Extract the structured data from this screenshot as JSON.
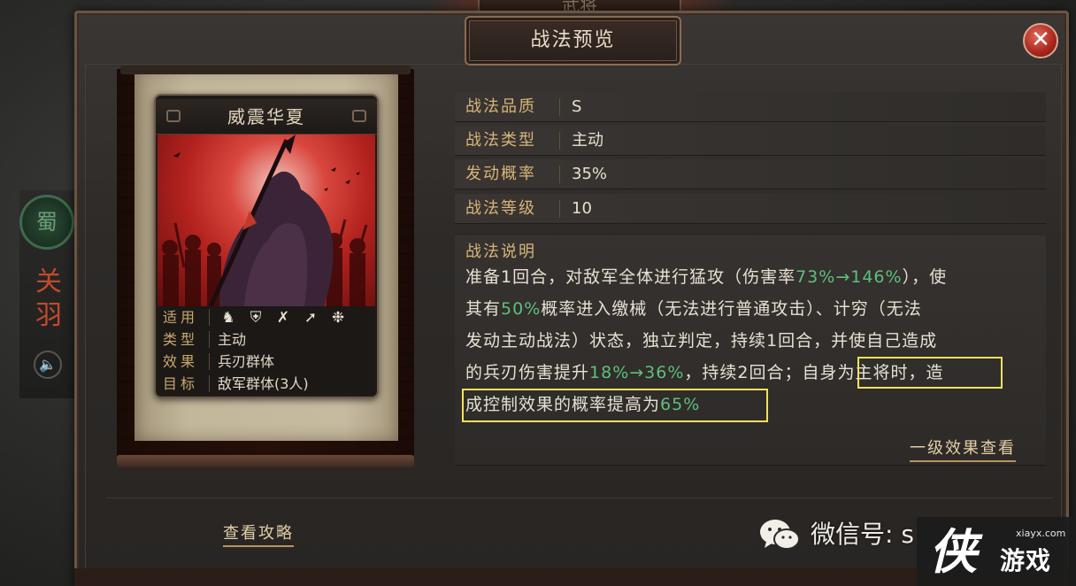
{
  "top_tab": {
    "label": "武将"
  },
  "side": {
    "nation": "蜀",
    "general_name": "关羽",
    "sound_icon": "speaker-icon"
  },
  "dialog": {
    "title": "战法预览",
    "close_icon": "close-icon"
  },
  "card": {
    "name": "威震华夏",
    "info": [
      {
        "key": "适用",
        "icons": [
          "cavalry-icon",
          "shield-icon",
          "bow-icon",
          "spear-icon",
          "wheel-icon"
        ]
      },
      {
        "key": "类型",
        "value": "主动"
      },
      {
        "key": "效果",
        "value": "兵刃群体"
      },
      {
        "key": "目标",
        "value": "敌军群体(3人)"
      }
    ]
  },
  "attributes": [
    {
      "key": "战法品质",
      "value": "S"
    },
    {
      "key": "战法类型",
      "value": "主动"
    },
    {
      "key": "发动概率",
      "value": "35%"
    },
    {
      "key": "战法等级",
      "value": "10"
    }
  ],
  "description": {
    "heading": "战法说明",
    "line1": {
      "a": "准备1回合，对敌军全体进行猛攻（伤害率",
      "g": "73%→146%",
      "b": "），使"
    },
    "line2": {
      "a": "其有",
      "g": "50%",
      "b": "概率进入缴械（无法进行普通攻击）、计穷（无法"
    },
    "line3": {
      "a": "发动主动战法）状态，独立判定，持续1回合，并使自己造成"
    },
    "line4": {
      "a": "的兵刃伤害提升",
      "g": "18%→36%",
      "b": "，持续2回合；",
      "hl": "自身为主将时",
      "c": "，造"
    },
    "line5": {
      "a": "成控制效果的概率提高为",
      "g": "65%"
    },
    "level_link": "一级效果查看"
  },
  "footer": {
    "guide_link": "查看攻略"
  },
  "watermark": {
    "wechat_label": "微信号: s",
    "wechat_icon": "wechat-icon",
    "site_url": "xiayx.com",
    "site_char": "侠",
    "site_name": "游戏"
  },
  "colors": {
    "accent_green": "#5fbf7d",
    "highlight_box": "#f1e25a",
    "label_gold": "#d6b57a",
    "close_red": "#a8261c"
  }
}
